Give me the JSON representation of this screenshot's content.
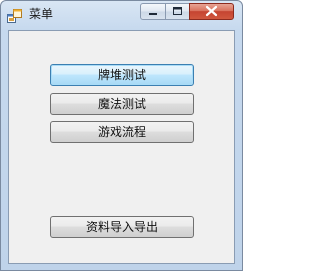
{
  "window": {
    "title": "菜单",
    "controls": {
      "minimize": "minimize",
      "maximize": "maximize",
      "close": "close"
    }
  },
  "buttons": {
    "card_stack_test": "牌堆测试",
    "magic_test": "魔法测试",
    "game_flow": "游戏流程",
    "data_import_export": "资料导入导出"
  },
  "colors": {
    "close_button": "#c54431",
    "focus_border": "#3c7fb1"
  }
}
